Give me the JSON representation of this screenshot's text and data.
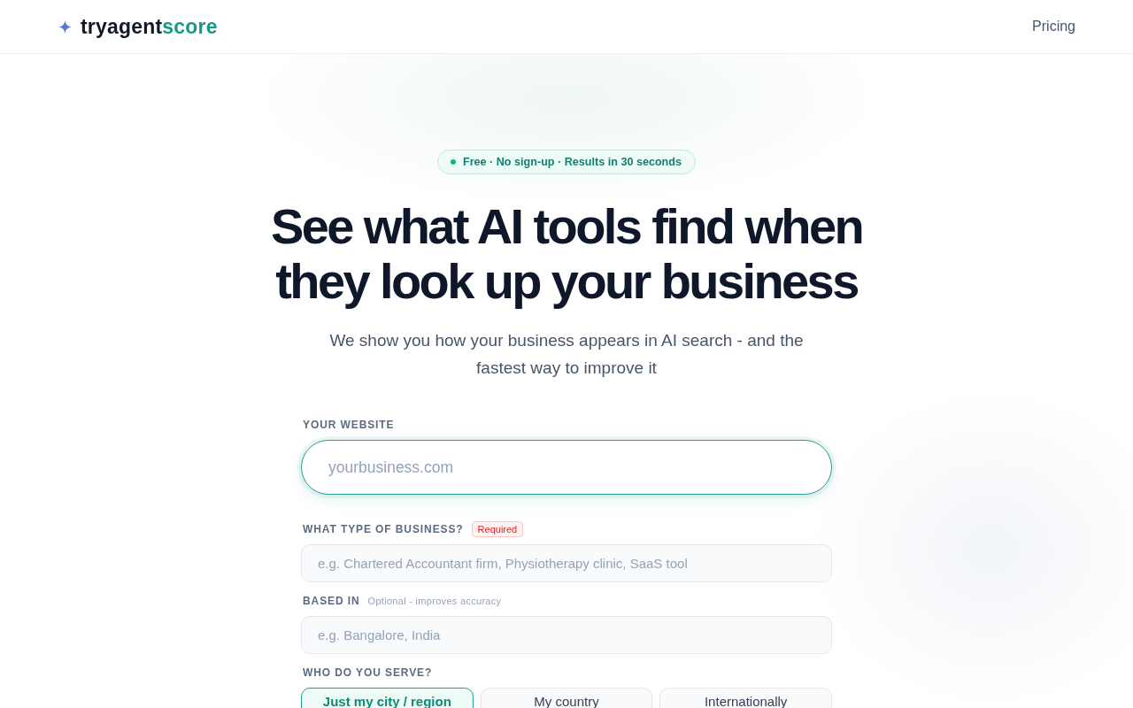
{
  "header": {
    "logo": {
      "parts": [
        {
          "text": "tryagent",
          "kind": "base"
        },
        {
          "text": "score",
          "kind": "accent"
        }
      ]
    },
    "nav": [
      {
        "label": "Pricing"
      }
    ]
  },
  "hero": {
    "badge": "Free · No sign-up · Results in 30 seconds",
    "title": "See what AI tools find when they look up your business",
    "subtitle": "We show you how your business appears in AI search - and the fastest way to improve it"
  },
  "form": {
    "fields": [
      {
        "kind": "primary",
        "label": "YOUR WEBSITE",
        "placeholder": "yourbusiness.com"
      },
      {
        "kind": "plain",
        "label": "WHAT TYPE OF BUSINESS?",
        "tag": "Required",
        "placeholder": "e.g. Chartered Accountant firm, Physiotherapy clinic, SaaS tool"
      },
      {
        "kind": "plain",
        "label": "BASED IN",
        "note": "Optional - improves accuracy",
        "placeholder": "e.g. Bangalore, India"
      }
    ],
    "audience": {
      "label": "WHO DO YOU SERVE?",
      "options": [
        {
          "label": "Just my city / region",
          "selected": true
        },
        {
          "label": "My country",
          "selected": false
        },
        {
          "label": "Internationally",
          "selected": false
        }
      ]
    }
  }
}
